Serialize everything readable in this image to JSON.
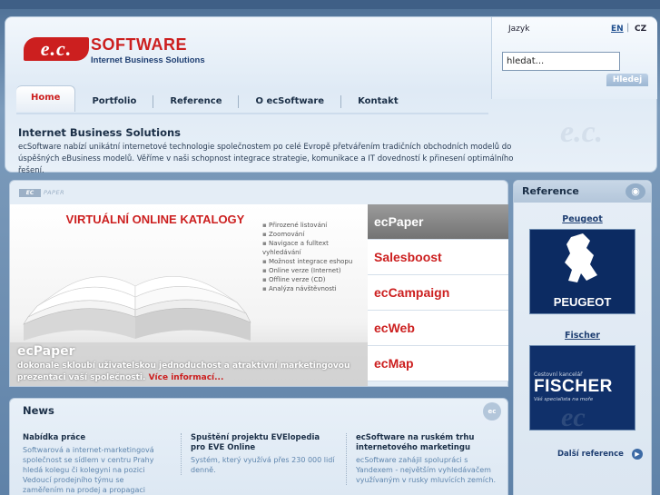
{
  "logo": {
    "badge": "e.c.",
    "name": "SOFTWARE",
    "tagline": "Internet Business Solutions"
  },
  "lang": {
    "label": "Jazyk",
    "en": "EN",
    "separator": "|",
    "cz": "CZ"
  },
  "search": {
    "value": "hledat...",
    "button": "Hledej"
  },
  "nav": {
    "items": [
      "Home",
      "Portfolio",
      "Reference",
      "O ecSoftware",
      "Kontakt"
    ]
  },
  "intro": {
    "title": "Internet Business Solutions",
    "text": "ecSoftware nabízí unikátní internetové technologie společnostem po celé Evropě přetvářením tradičních obchodních modelů do úspěšných eBusiness modelů. Věříme v naši schopnost integrace strategie, komunikace a IT dovedností k přinesení optimálního řešení.",
    "watermark": "e.c."
  },
  "promo": {
    "brand_badge": "EC",
    "brand_word": "PAPER",
    "headline": "VIRTUÁLNÍ ONLINE KATALOGY",
    "features": [
      "Přirozené listování",
      "Zoomování",
      "Navigace a fulltext vyhledávání",
      "Možnost integrace eshopu",
      "Online verze (Internet)",
      "Offline verze (CD)",
      "Analýza návštěvnosti"
    ],
    "title": "ecPaper",
    "desc": "dokonale skloubí uživatelskou jednoduchost a atraktivní marketingovou prezentaci vaší společnosti.",
    "more": "Více informací..."
  },
  "products": [
    "ecPaper",
    "Salesboost",
    "ecCampaign",
    "ecWeb",
    "ecMap"
  ],
  "news": {
    "title": "News",
    "icon_text": "ec",
    "items": [
      {
        "title": "Nabídka práce",
        "text": "Softwarová a internet-marketingová společnost se sídlem v centru Prahy hledá kolegu či kolegyni na pozici Vedoucí prodejního týmu se zaměřením na prodej a propagaci"
      },
      {
        "title": "Spuštění projektu EVElopedia pro EVE Online",
        "text": "Systém, který využívá přes 230 000 lidí denně."
      },
      {
        "title": "ecSoftware na ruském trhu internetového marketingu",
        "text": "ecSoftware zahájil spolupráci s Yandexem - největším vyhledávačem využívaným v rusky mluvících zemích."
      }
    ]
  },
  "references": {
    "title": "Reference",
    "items": [
      {
        "name": "Peugeot",
        "logo_text": "PEUGEOT"
      },
      {
        "name": "Fischer",
        "logo_small": "Cestovní kancelář",
        "logo_text": "FISCHER",
        "logo_tag": "Váš specialista na moře",
        "logo_ec": "ec"
      }
    ],
    "more": "Další reference"
  },
  "colors": {
    "brand_red": "#cc1f1f",
    "navy": "#1f3f72",
    "page_blue": "#7d9cbc"
  }
}
